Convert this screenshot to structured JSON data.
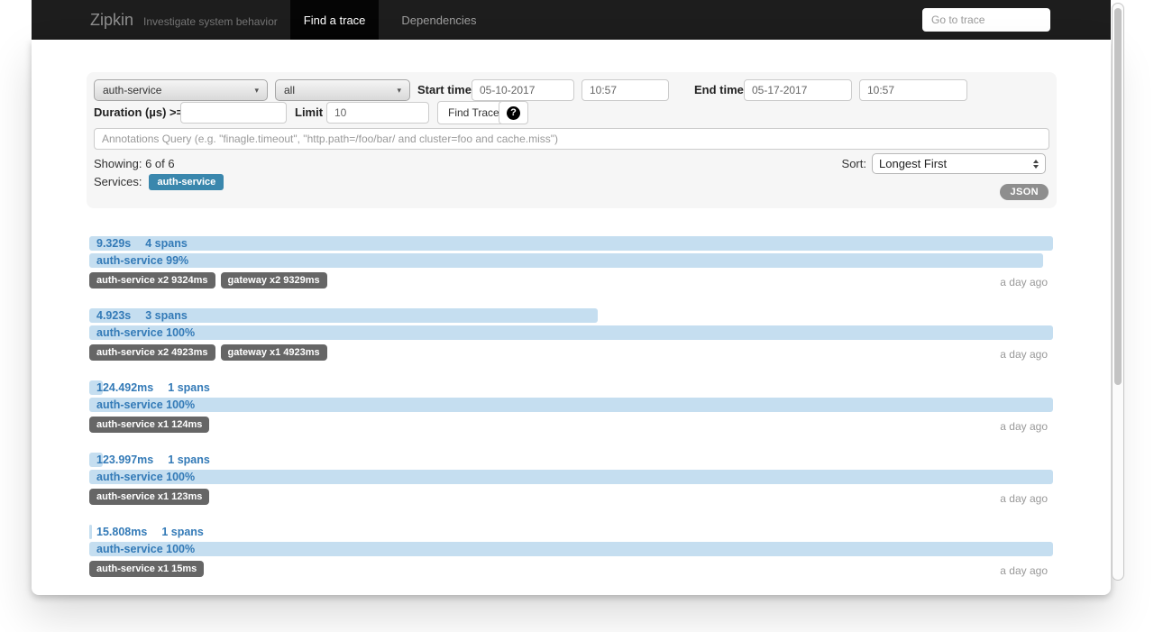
{
  "navbar": {
    "brand": "Zipkin",
    "subtitle": "Investigate system behavior",
    "tabs": [
      {
        "label": "Find a trace",
        "active": true
      },
      {
        "label": "Dependencies",
        "active": false
      }
    ],
    "go_to_trace_placeholder": "Go to trace"
  },
  "search_form": {
    "service_select_value": "auth-service",
    "span_select_value": "all",
    "start_time_label": "Start time",
    "start_date": "05-10-2017",
    "start_time": "10:57",
    "end_time_label": "End time",
    "end_date": "05-17-2017",
    "end_time": "10:57",
    "duration_label": "Duration (µs) >=",
    "limit_label": "Limit",
    "limit_value": "10",
    "find_traces_label": "Find Traces",
    "help_icon": "question-sign",
    "annotations_placeholder": "Annotations Query (e.g. \"finagle.timeout\", \"http.path=/foo/bar/ and cluster=foo and cache.miss\")",
    "showing_text": "Showing: 6 of 6",
    "sort_label": "Sort:",
    "sort_value": "Longest First",
    "services_label": "Services:",
    "service_badges": [
      "auth-service"
    ],
    "json_button_label": "JSON"
  },
  "traces": [
    {
      "duration": "9.329s",
      "span_count": "4 spans",
      "duration_pct": 100,
      "service_breakdown": "auth-service 99%",
      "service_pct": 99,
      "tags": [
        "auth-service x2 9324ms",
        "gateway x2 9329ms"
      ],
      "age": "a day ago"
    },
    {
      "duration": "4.923s",
      "span_count": "3 spans",
      "duration_pct": 52.8,
      "service_breakdown": "auth-service 100%",
      "service_pct": 100,
      "tags": [
        "auth-service x2 4923ms",
        "gateway x1 4923ms"
      ],
      "age": "a day ago"
    },
    {
      "duration": "124.492ms",
      "span_count": "1 spans",
      "duration_pct": 1.4,
      "service_breakdown": "auth-service 100%",
      "service_pct": 100,
      "tags": [
        "auth-service x1 124ms"
      ],
      "age": "a day ago"
    },
    {
      "duration": "123.997ms",
      "span_count": "1 spans",
      "duration_pct": 1.4,
      "service_breakdown": "auth-service 100%",
      "service_pct": 100,
      "tags": [
        "auth-service x1 123ms"
      ],
      "age": "a day ago"
    },
    {
      "duration": "15.808ms",
      "span_count": "1 spans",
      "duration_pct": 0.3,
      "service_breakdown": "auth-service 100%",
      "service_pct": 100,
      "tags": [
        "auth-service x1 15ms"
      ],
      "age": "a day ago"
    }
  ],
  "colors": {
    "navbar_bg": "#1d1d1d",
    "active_tab_bg": "#050505",
    "bar_blue": "#c5def0",
    "link_blue": "#337ab7",
    "tag_bg": "#666666",
    "service_badge_bg": "#3a87ad",
    "json_btn_bg": "#8e8e8e"
  }
}
